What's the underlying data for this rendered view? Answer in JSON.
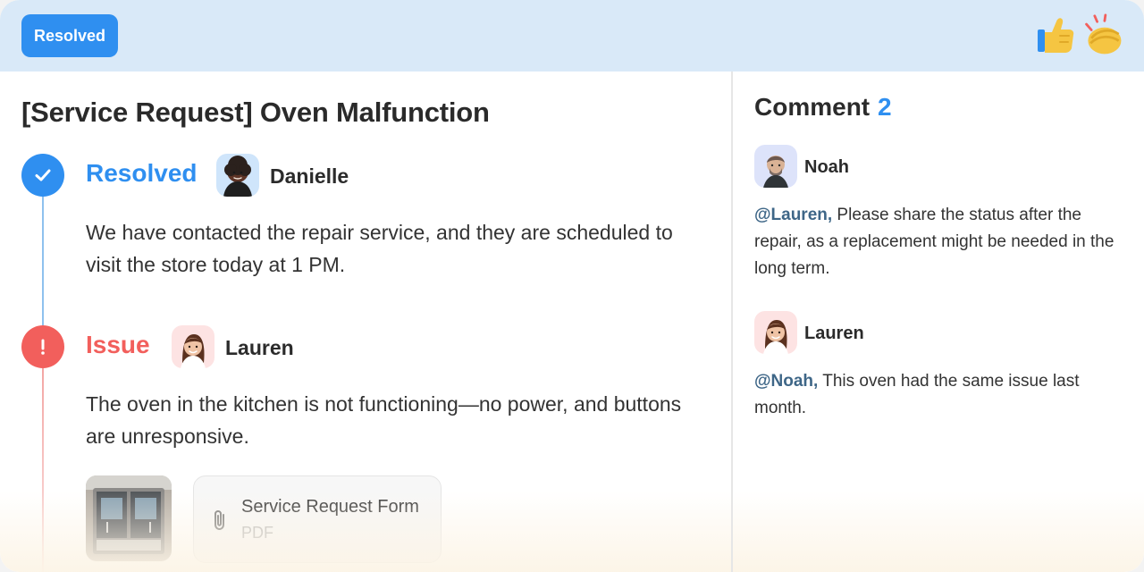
{
  "header": {
    "status_badge": "Resolved",
    "reactions": [
      {
        "icon": "thumbs-up-icon"
      },
      {
        "icon": "clapping-hands-icon"
      }
    ]
  },
  "ticket": {
    "title": "[Service Request] Oven Malfunction",
    "entries": [
      {
        "status": "Resolved",
        "status_color": "#2f8ff0",
        "author": "Danielle",
        "text": "We have contacted the repair service, and they are scheduled to visit the store today at 1 PM."
      },
      {
        "status": "Issue",
        "status_color": "#f25f5c",
        "author": "Lauren",
        "text": "The oven in the kitchen is not functioning—no power, and buttons are unresponsive.",
        "attachment": {
          "name": "Service Request Form",
          "type": "PDF"
        }
      }
    ]
  },
  "comments": {
    "heading": "Comment",
    "count": "2",
    "items": [
      {
        "author": "Noah",
        "mention": "@Lauren,",
        "text": " Please share the status after the repair, as a replacement might be needed in the long term."
      },
      {
        "author": "Lauren",
        "mention": "@Noah,",
        "text": " This oven had the same issue last month."
      }
    ]
  },
  "colors": {
    "accent_blue": "#2f8ff0",
    "issue_red": "#f25f5c",
    "header_bg": "#d9e9f8",
    "mention": "#3e6687"
  }
}
